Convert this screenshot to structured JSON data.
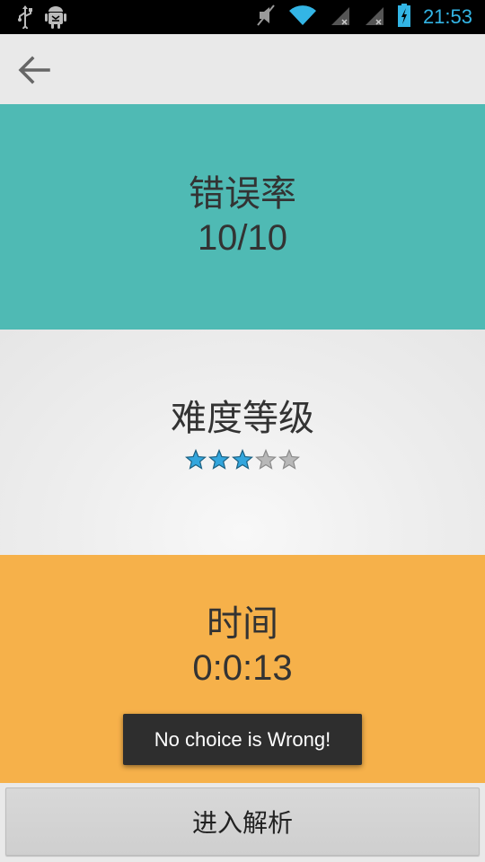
{
  "status_bar": {
    "time": "21:53",
    "icons": [
      "usb-icon",
      "android-debug-icon",
      "mute-icon",
      "wifi-icon",
      "signal-icon",
      "signal-icon-2",
      "battery-charging-icon"
    ],
    "accent_color": "#33b5e5"
  },
  "action_bar": {
    "back_icon": "back-arrow-icon"
  },
  "error_rate": {
    "title": "错误率",
    "value": "10/10",
    "color": "#4fbab4"
  },
  "difficulty": {
    "title": "难度等级",
    "rating": 3,
    "max_rating": 5,
    "star_color_filled": "#33a6dd",
    "star_color_empty": "#b8b8b8"
  },
  "time": {
    "title": "时间",
    "value": "0:0:13",
    "color": "#f6b14a"
  },
  "toast": {
    "message": "No choice is Wrong!"
  },
  "bottom": {
    "button_label": "进入解析"
  }
}
